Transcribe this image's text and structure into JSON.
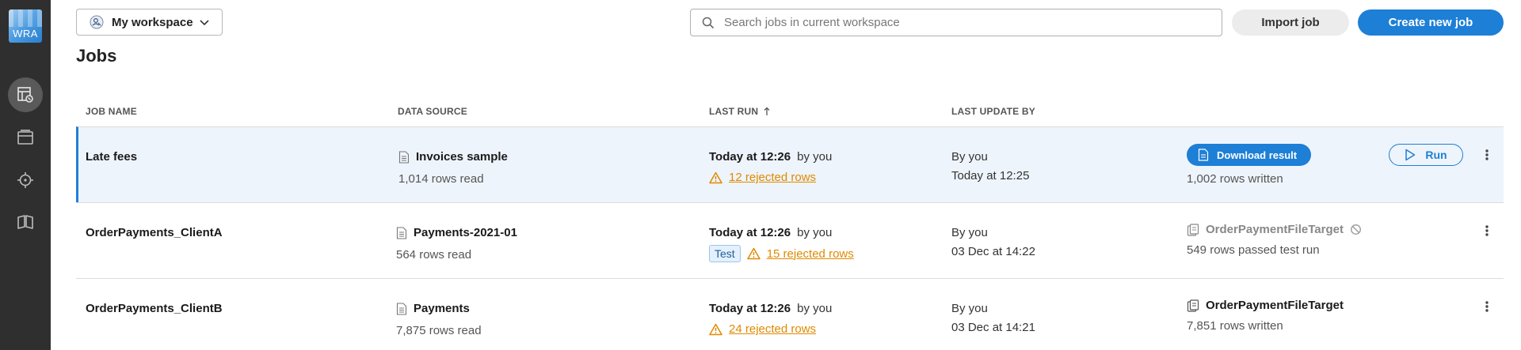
{
  "app": {
    "logo_text": "WRA"
  },
  "rail": {
    "items": [
      {
        "name": "jobs",
        "icon": "jobs-icon",
        "active": true
      },
      {
        "name": "files",
        "icon": "folder-icon",
        "active": false
      },
      {
        "name": "monitor",
        "icon": "target-icon",
        "active": false
      },
      {
        "name": "docs",
        "icon": "book-icon",
        "active": false
      }
    ]
  },
  "workspace": {
    "label": "My workspace",
    "icon": "workspace-user-icon"
  },
  "search": {
    "placeholder": "Search jobs in current workspace",
    "value": ""
  },
  "buttons": {
    "import": "Import job",
    "create": "Create new job"
  },
  "page": {
    "title": "Jobs"
  },
  "table": {
    "headers": {
      "job_name": "JOB NAME",
      "data_source": "DATA SOURCE",
      "last_run": "LAST RUN",
      "last_update_by": "LAST UPDATE BY"
    },
    "sort": {
      "column": "last_run",
      "direction": "asc"
    },
    "rows": [
      {
        "job_name": "Late fees",
        "source_name": "Invoices sample",
        "rows_read": "1,014 rows read",
        "run_time": "Today at 12:26",
        "run_by": "by you",
        "test_badge": "",
        "rejected": "12 rejected rows",
        "update_by": "By you",
        "update_time": "Today at 12:25",
        "target_action": "Download result",
        "target_detail": "1,002 rows written",
        "run_label": "Run"
      },
      {
        "job_name": "OrderPayments_ClientA",
        "source_name": "Payments-2021-01",
        "rows_read": "564 rows read",
        "run_time": "Today at 12:26",
        "run_by": "by you",
        "test_badge": "Test",
        "rejected": "15 rejected rows",
        "update_by": "By you",
        "update_time": "03 Dec at 14:22",
        "target_name": "OrderPaymentFileTarget",
        "target_detail": "549 rows passed test run"
      },
      {
        "job_name": "OrderPayments_ClientB",
        "source_name": "Payments",
        "rows_read": "7,875 rows read",
        "run_time": "Today at 12:26",
        "run_by": "by you",
        "test_badge": "",
        "rejected": "24 rejected rows",
        "update_by": "By you",
        "update_time": "03 Dec at 14:21",
        "target_name": "OrderPaymentFileTarget",
        "target_detail": "7,851 rows written"
      }
    ]
  },
  "colors": {
    "accent": "#1d7fd6",
    "warning": "#e08a00",
    "rail": "#2f2f2f",
    "selected_row": "#eef4fb"
  }
}
